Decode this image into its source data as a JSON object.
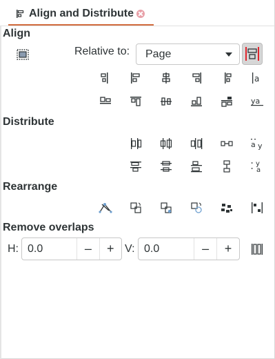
{
  "tab": {
    "title": "Align and Distribute",
    "icon": "align-distribute-icon",
    "accent_color": "#d16a3c"
  },
  "align": {
    "heading": "Align",
    "relative_label": "Relative to:",
    "relative_value": "Page",
    "row1": [
      "align-right-edges-to-left-icon",
      "align-left-edges-icon",
      "center-on-vertical-axis-icon",
      "align-right-edges-icon",
      "align-left-edges-to-right-icon",
      "align-baseline-text-icon"
    ],
    "row2": [
      "align-bottom-to-top-icon",
      "align-top-edges-icon",
      "center-on-horizontal-axis-icon",
      "align-bottom-edges-icon",
      "align-top-to-bottom-icon",
      "align-baseline-anchors-icon"
    ]
  },
  "distribute": {
    "heading": "Distribute",
    "row1": [
      "distribute-left-edges-icon",
      "distribute-centers-horizontal-icon",
      "distribute-right-edges-icon",
      "distribute-gaps-horizontal-icon",
      "distribute-baselines-horizontal-icon"
    ],
    "row2": [
      "distribute-top-edges-icon",
      "distribute-centers-vertical-icon",
      "distribute-bottom-edges-icon",
      "distribute-gaps-vertical-icon",
      "distribute-baselines-vertical-icon"
    ]
  },
  "rearrange": {
    "heading": "Rearrange",
    "icons": [
      "graph-layout-icon",
      "exchange-selection-order-icon",
      "exchange-z-order-icon",
      "exchange-clockwise-icon",
      "randomize-positions-icon",
      "unclump-icon"
    ]
  },
  "overlaps": {
    "heading": "Remove overlaps",
    "h_label": "H:",
    "h_value": "0.0",
    "v_label": "V:",
    "v_value": "0.0",
    "minus": "–",
    "plus": "+",
    "apply_icon": "remove-overlaps-icon"
  }
}
